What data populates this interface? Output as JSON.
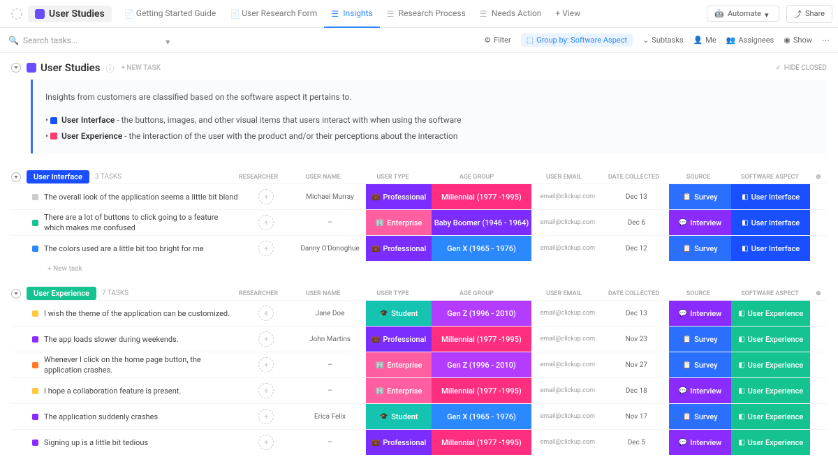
{
  "header": {
    "title": "User Studies",
    "tabs": [
      {
        "label": "Getting Started Guide"
      },
      {
        "label": "User Research Form"
      },
      {
        "label": "Insights"
      },
      {
        "label": "Research Process"
      },
      {
        "label": "Needs Action"
      }
    ],
    "add_view": "+  View",
    "automate": "Automate",
    "share": "Share"
  },
  "filterbar": {
    "search_placeholder": "Search tasks...",
    "filter": "Filter",
    "groupby": "Group by: Software Aspect",
    "subtasks": "Subtasks",
    "me": "Me",
    "assignees": "Assignees",
    "show": "Show"
  },
  "list": {
    "title": "User Studies",
    "new_task": "+ NEW TASK",
    "hide_closed": "HIDE CLOSED"
  },
  "insight": {
    "intro": "Insights from customers are classified based on the software aspect it pertains to.",
    "ui_label": "User Interface",
    "ui_desc": " - the buttons, images, and other visual items that users interact with when using the software",
    "ux_label": "User Experience",
    "ux_desc": " - the interaction of the user with the product and/or their perceptions about the interaction"
  },
  "columns": {
    "researcher": "RESEARCHER",
    "user_name": "USER NAME",
    "user_type": "USER TYPE",
    "age_group": "AGE GROUP",
    "user_email": "USER EMAIL",
    "date_collected": "DATE COLLECTED",
    "source": "SOURCE",
    "software_aspect": "SOFTWARE ASPECT"
  },
  "groups": [
    {
      "name": "User Interface",
      "class": "ui",
      "count": "3 TASKS",
      "tasks": [
        {
          "status": "#ccc",
          "text": "The overall look of the application seems a little bit bland",
          "user": "Michael Murray",
          "type": "Professional",
          "type_bg": "#7b2cff",
          "age": "Millennial (1977 -1995)",
          "age_bg": "#ff2e7e",
          "email": "email@clickup.com",
          "date": "Dec 13",
          "src": "Survey",
          "src_bg": "#2b6fff",
          "asp": "User Interface",
          "asp_bg": "#1a4fff"
        },
        {
          "status": "#14c38f",
          "text": "There are a lot of buttons to click going to a feature which makes me confused",
          "user": "–",
          "type": "Enterprise",
          "type_bg": "#ff5fa0",
          "age": "Baby Boomer (1946 - 1964)",
          "age_bg": "#7b2cff",
          "email": "email@clickup.com",
          "date": "Dec 6",
          "src": "Interview",
          "src_bg": "#8a2cff",
          "asp": "User Interface",
          "asp_bg": "#1a4fff"
        },
        {
          "status": "#2b88ff",
          "text": "The colors used are a little bit too bright for me",
          "user": "Danny O'Donoghue",
          "type": "Professional",
          "type_bg": "#7b2cff",
          "age": "Gen X (1965 - 1976)",
          "age_bg": "#2b88ff",
          "email": "email@clickup.com",
          "date": "Dec 12",
          "src": "Survey",
          "src_bg": "#2b6fff",
          "asp": "User Interface",
          "asp_bg": "#1a4fff"
        }
      ]
    },
    {
      "name": "User Experience",
      "class": "ux",
      "count": "7 TASKS",
      "tasks": [
        {
          "status": "#ffc93b",
          "text": "I wish the theme of the application can be customized.",
          "user": "Jane Doe",
          "type": "Student",
          "type_bg": "#14c3b0",
          "age": "Gen Z (1996 - 2010)",
          "age_bg": "#b43cff",
          "email": "email@clickup.com",
          "date": "Dec 13",
          "src": "Interview",
          "src_bg": "#8a2cff",
          "asp": "User Experience",
          "asp_bg": "#14c38f"
        },
        {
          "status": "#8a2cff",
          "text": "The app loads slower during weekends.",
          "user": "John Martins",
          "type": "Professional",
          "type_bg": "#7b2cff",
          "age": "Millennial (1977 -1995)",
          "age_bg": "#ff2e7e",
          "email": "email@clickup.com",
          "date": "Nov 23",
          "src": "Survey",
          "src_bg": "#2b6fff",
          "asp": "User Experience",
          "asp_bg": "#14c38f"
        },
        {
          "status": "#ff7b2c",
          "text": "Whenever I click on the home page button, the application crashes.",
          "user": "–",
          "type": "Enterprise",
          "type_bg": "#ff5fa0",
          "age": "Gen Z (1996 - 2010)",
          "age_bg": "#b43cff",
          "email": "email@clickup.com",
          "date": "Nov 27",
          "src": "Survey",
          "src_bg": "#2b6fff",
          "asp": "User Experience",
          "asp_bg": "#14c38f"
        },
        {
          "status": "#ffc93b",
          "text": "I hope a collaboration feature is present.",
          "user": "–",
          "type": "Enterprise",
          "type_bg": "#ff5fa0",
          "age": "Millennial (1977 -1995)",
          "age_bg": "#ff2e7e",
          "email": "email@clickup.com",
          "date": "Dec 18",
          "src": "Interview",
          "src_bg": "#8a2cff",
          "asp": "User Experience",
          "asp_bg": "#14c38f"
        },
        {
          "status": "#8a2cff",
          "text": "The application suddenly crashes",
          "user": "Erica Felix",
          "type": "Student",
          "type_bg": "#14c3b0",
          "age": "Gen X (1965 - 1976)",
          "age_bg": "#2b88ff",
          "email": "email@clickup.com",
          "date": "Nov 17",
          "src": "Survey",
          "src_bg": "#2b6fff",
          "asp": "User Experience",
          "asp_bg": "#14c38f"
        },
        {
          "status": "#8a2cff",
          "text": "Signing up is a little bit tedious",
          "user": "–",
          "type": "Professional",
          "type_bg": "#7b2cff",
          "age": "Millennial (1977 -1995)",
          "age_bg": "#ff2e7e",
          "email": "email@clickup.com",
          "date": "Dec 5",
          "src": "Interview",
          "src_bg": "#8a2cff",
          "asp": "User Experience",
          "asp_bg": "#14c38f"
        }
      ]
    }
  ],
  "add_task": "+ New task"
}
